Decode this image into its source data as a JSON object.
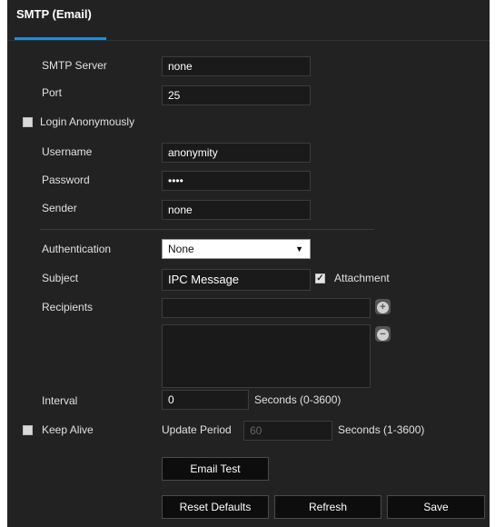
{
  "header": {
    "tab_label": "SMTP (Email)"
  },
  "form": {
    "smtp_server": {
      "label": "SMTP Server",
      "value": "none"
    },
    "port": {
      "label": "Port",
      "value": "25"
    },
    "login_anonymously": {
      "label": "Login Anonymously",
      "checked": false
    },
    "username": {
      "label": "Username",
      "value": "anonymity"
    },
    "password": {
      "label": "Password",
      "value": "••••"
    },
    "sender": {
      "label": "Sender",
      "value": "none"
    },
    "authentication": {
      "label": "Authentication",
      "value": "None"
    },
    "subject": {
      "label": "Subject",
      "value": "IPC Message"
    },
    "attachment": {
      "label": "Attachment",
      "checked": true
    },
    "recipients": {
      "label": "Recipients",
      "value": ""
    },
    "interval": {
      "label": "Interval",
      "value": "0",
      "unit": "Seconds (0-3600)"
    },
    "keep_alive": {
      "label": "Keep Alive",
      "checked": false
    },
    "update_period": {
      "label": "Update Period",
      "value": "60",
      "unit": "Seconds (1-3600)"
    }
  },
  "buttons": {
    "email_test": "Email Test",
    "reset_defaults": "Reset Defaults",
    "refresh": "Refresh",
    "save": "Save"
  },
  "icons": {
    "add": "plus-circle-icon",
    "remove": "minus-circle-icon"
  },
  "colors": {
    "panel_bg": "#222222",
    "accent": "#1e8fd8"
  }
}
